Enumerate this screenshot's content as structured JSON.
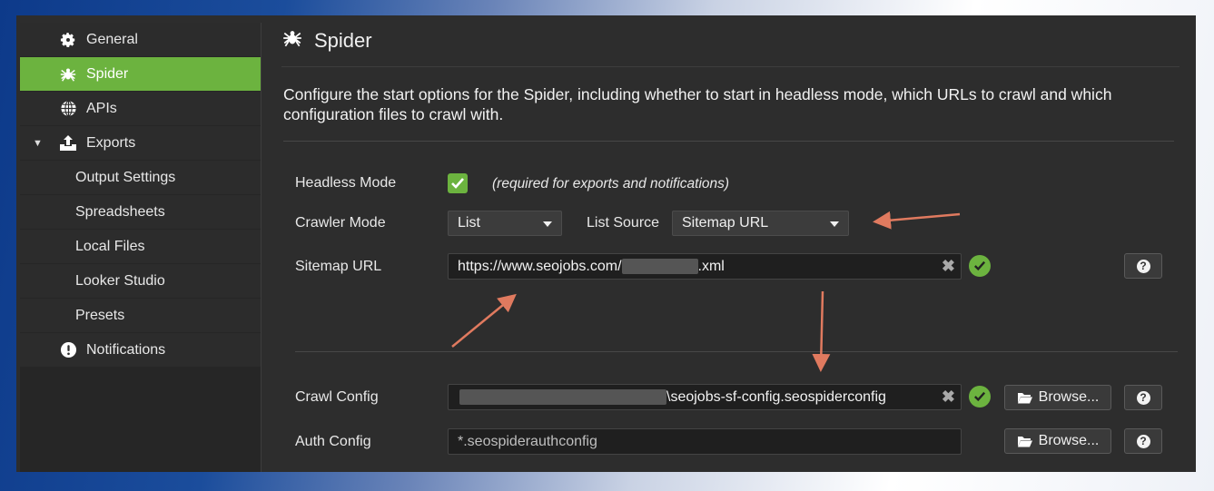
{
  "sidebar": {
    "items": [
      {
        "label": "General",
        "icon": "gear-icon"
      },
      {
        "label": "Spider",
        "icon": "spider-icon",
        "active": true
      },
      {
        "label": "APIs",
        "icon": "globe-icon"
      },
      {
        "label": "Exports",
        "icon": "upload-icon",
        "expanded": true
      },
      {
        "label": "Output Settings"
      },
      {
        "label": "Spreadsheets"
      },
      {
        "label": "Local Files"
      },
      {
        "label": "Looker Studio"
      },
      {
        "label": "Presets"
      },
      {
        "label": "Notifications",
        "icon": "exclamation-circle-icon"
      }
    ]
  },
  "header": {
    "title": "Spider",
    "description": "Configure the start options for the Spider, including whether to start in headless mode, which URLs to crawl and which configuration files to crawl with."
  },
  "form": {
    "headless_label": "Headless Mode",
    "headless_checked": true,
    "headless_note": "(required for exports and notifications)",
    "crawler_mode_label": "Crawler Mode",
    "crawler_mode_value": "List",
    "list_source_label": "List Source",
    "list_source_value": "Sitemap URL",
    "sitemap_label": "Sitemap URL",
    "sitemap_prefix": "https://www.seojobs.com/",
    "sitemap_suffix": ".xml",
    "crawl_config_label": "Crawl Config",
    "crawl_config_value": "\\seojobs-sf-config.seospiderconfig",
    "auth_config_label": "Auth Config",
    "auth_config_placeholder": "*.seospiderauthconfig",
    "browse_label": "Browse...",
    "help_label": "?",
    "clear_label": "✖"
  },
  "colors": {
    "accent": "#6cb33f",
    "panel": "#2d2d2d",
    "annotation_arrow": "#e07a5f"
  }
}
